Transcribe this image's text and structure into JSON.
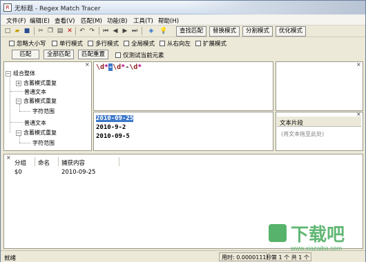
{
  "window": {
    "title": "无标题 - Regex Match Tracer",
    "icon_label": "R"
  },
  "menu": [
    "文件(F)",
    "编辑(E)",
    "查看(V)",
    "匹配(M)",
    "功能(B)",
    "工具(T)",
    "帮助(H)"
  ],
  "toolbar": {
    "buttons": [
      "查找匹配",
      "替换模式",
      "分割模式",
      "优化模式"
    ]
  },
  "options": [
    "忽略大小写",
    "单行模式",
    "多行模式",
    "全局模式",
    "从右向左",
    "扩展模式"
  ],
  "actions": {
    "match": "匹配",
    "match_all": "全部匹配",
    "reset": "匹配重置",
    "test_current": "仅测试当前元素"
  },
  "tree": {
    "root": "组合整体",
    "items": [
      "含蓄模式重复",
      "普通文本",
      "含蓄模式重复",
      "字符范围",
      "普通文本",
      "含蓄模式重复",
      "字符范围"
    ]
  },
  "regex": {
    "parts": [
      "\\d",
      "*",
      "-",
      "\\d",
      "*",
      "-",
      "\\d",
      "*"
    ]
  },
  "text": {
    "lines": [
      "2010-09-25",
      "2010-9-2",
      "2010-09-5"
    ]
  },
  "snippet": {
    "title": "文本片段",
    "placeholder": "(将文本拖至此处)"
  },
  "results": {
    "columns": [
      "分组",
      "命名",
      "捕获内容"
    ],
    "rows": [
      {
        "group": "$0",
        "name": "",
        "capture": "2010-09-25"
      }
    ]
  },
  "status": {
    "ready": "就绪",
    "time": "用时: 0.0000111秒",
    "position": "第 1 个 共 1 个"
  },
  "colors": {
    "selection": "#3d78c9",
    "regex_token": "#8b1a1a",
    "regex_quantifier": "#b0007a",
    "watermark": "#3aa651"
  },
  "watermark": {
    "brand": "下载吧",
    "domain": "www.xiazaiba.com"
  }
}
